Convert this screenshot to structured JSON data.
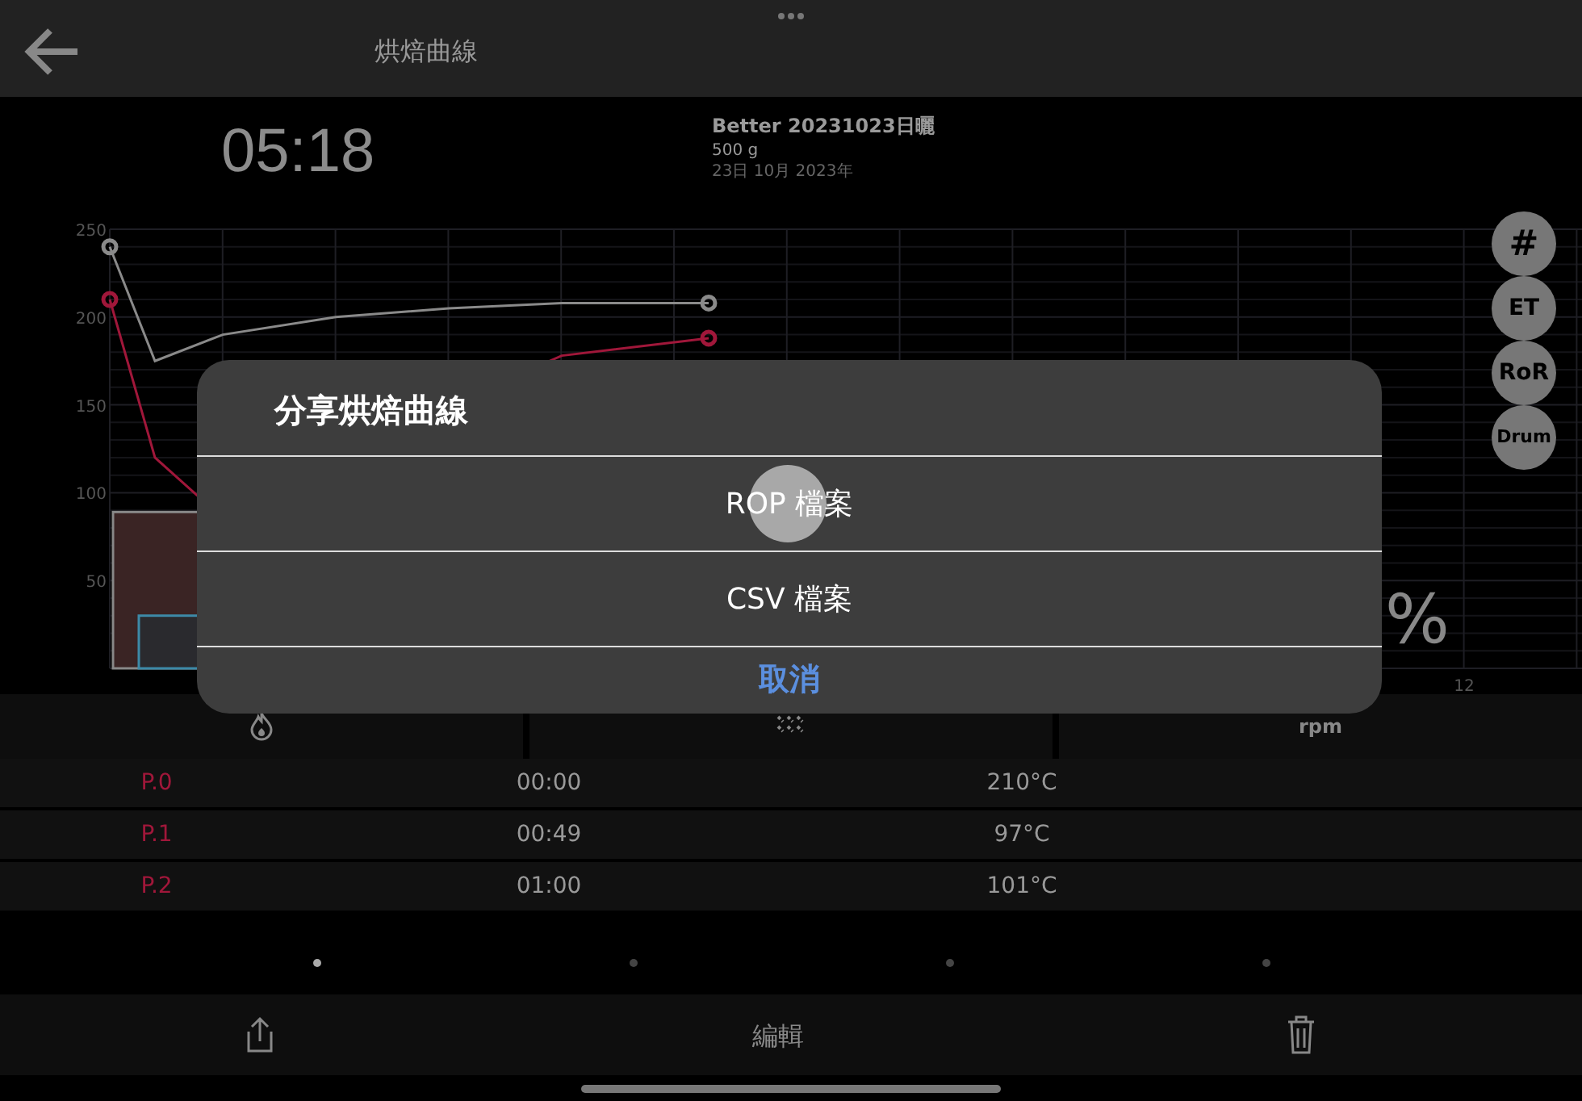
{
  "header": {
    "title": "烘焙曲線"
  },
  "roast": {
    "elapsed": "05:18",
    "name": "Better 20231023日曬",
    "weight": "500 g",
    "date": "23日 10月 2023年"
  },
  "chart": {
    "y_axis_labels": [
      "250",
      "200",
      "150",
      "100",
      "50"
    ],
    "x_axis_label": "12",
    "percent_readout": "%",
    "toggles": [
      {
        "label": "#"
      },
      {
        "label": "ET"
      },
      {
        "label": "RoR"
      },
      {
        "label": "Drum"
      }
    ]
  },
  "dialog": {
    "title": "分享烘焙曲線",
    "options": [
      "ROP 檔案",
      "CSV 檔案"
    ],
    "cancel": "取消"
  },
  "controls": [
    {
      "kind": "flame"
    },
    {
      "kind": "fan"
    },
    {
      "kind": "text",
      "label": "rpm"
    }
  ],
  "points": [
    {
      "label": "P.0",
      "time": "00:00",
      "temp": "210°C"
    },
    {
      "label": "P.1",
      "time": "00:49",
      "temp": "97°C"
    },
    {
      "label": "P.2",
      "time": "01:00",
      "temp": "101°C"
    }
  ],
  "pages": [
    {
      "selected": true
    },
    {
      "selected": false
    },
    {
      "selected": false
    },
    {
      "selected": false
    }
  ],
  "toolbar": {
    "edit": "編輯"
  }
}
